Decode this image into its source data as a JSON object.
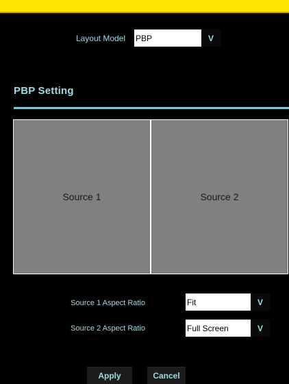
{
  "layout": {
    "label": "Layout Model",
    "value": "PBP",
    "dropdown_icon": "chevron-down-icon"
  },
  "section": {
    "title": "PBP Setting"
  },
  "preview": {
    "source1": "Source 1",
    "source2": "Source 2"
  },
  "aspect": {
    "source1_label": "Source 1 Aspect Ratio",
    "source1_value": "Fit",
    "source2_label": "Source 2 Aspect Ratio",
    "source2_value": "Full Screen",
    "dropdown_icon": "chevron-down-icon"
  },
  "buttons": {
    "apply": "Apply",
    "cancel": "Cancel"
  },
  "colors": {
    "topbar": "#ffe400",
    "accent": "#9fdbe3",
    "background": "#000000",
    "preview_fill": "#808080"
  }
}
